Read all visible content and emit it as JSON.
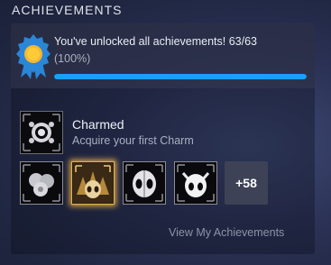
{
  "section": {
    "title": "ACHIEVEMENTS"
  },
  "progress": {
    "message": "You've unlocked all achievements! 63/63",
    "percent_label": "(100%)",
    "fraction_complete": 1.0,
    "bar_color": "#1a9fff",
    "medal_color": "#2a86d8"
  },
  "latest_achievement": {
    "title": "Charmed",
    "description": "Acquire your first Charm",
    "icon": "charm-icon"
  },
  "unlocked_icons": [
    {
      "icon": "bubbles-charm-icon",
      "highlight": false
    },
    {
      "icon": "golden-mask-icon",
      "highlight": true
    },
    {
      "icon": "hollow-knight-mask-icon",
      "highlight": false
    },
    {
      "icon": "white-mask-icon",
      "highlight": false
    }
  ],
  "more_count_label": "+58",
  "view_link_label": "View My Achievements"
}
